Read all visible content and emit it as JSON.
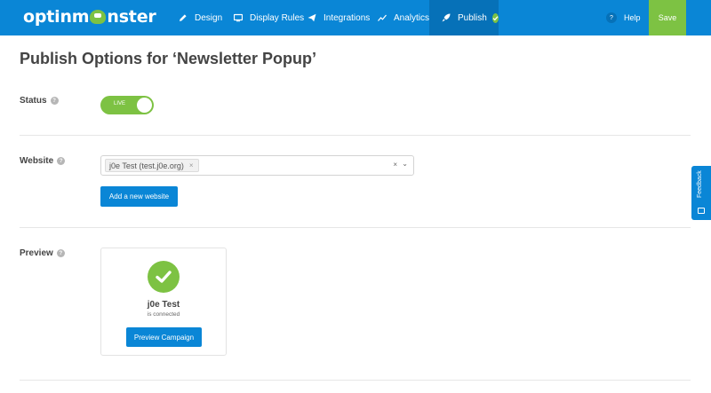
{
  "topbar": {
    "logo": {
      "before": "optinm",
      "after": "nster"
    },
    "nav": [
      {
        "label": "Design",
        "icon": "pencil-icon"
      },
      {
        "label": "Display Rules",
        "icon": "monitor-icon"
      },
      {
        "label": "Integrations",
        "icon": "paper-plane-icon"
      },
      {
        "label": "Analytics",
        "icon": "line-chart-icon"
      },
      {
        "label": "Publish",
        "icon": "rocket-icon",
        "active": true
      }
    ],
    "help_icon": "?",
    "help_label": "Help",
    "save_label": "Save"
  },
  "page": {
    "title": "Publish Options for ‘Newsletter Popup’"
  },
  "status": {
    "label": "Status",
    "toggle_label": "LIVE",
    "enabled": true
  },
  "website": {
    "label": "Website",
    "selected_chip": "j0e Test (test.j0e.org)",
    "chip_remove": "×",
    "clear": "×",
    "caret": "⌄",
    "add_button": "Add a new website"
  },
  "preview": {
    "label": "Preview",
    "site_name": "j0e Test",
    "site_status": "is connected",
    "button": "Preview Campaign"
  },
  "feedback": {
    "label": "Feedback"
  },
  "help_mark": "?",
  "colors": {
    "primary": "#0a86d6",
    "primary_dark": "#0671b8",
    "success": "#7dc243"
  }
}
